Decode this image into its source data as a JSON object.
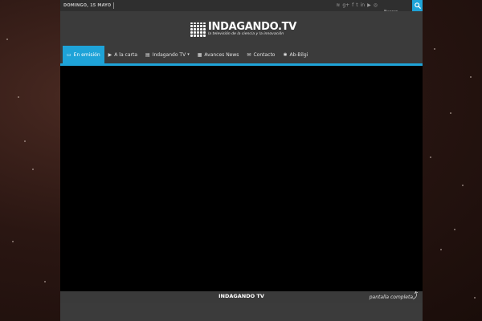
{
  "topbar": {
    "date": "DOMINGO, 15 MAYO",
    "social_icons": [
      "rss-icon",
      "google-plus-icon",
      "facebook-icon",
      "twitter-icon",
      "linkedin-icon",
      "youtube-icon",
      "instagram-icon"
    ],
    "social_glyphs": [
      "≋",
      "g+",
      "f",
      "t",
      "in",
      "▶",
      "◎"
    ],
    "search_placeholder": "Buscar"
  },
  "header": {
    "logo_title": "INDAGANDO.TV",
    "logo_subtitle": "la televisión de la ciencia y la innovación"
  },
  "nav": {
    "items": [
      {
        "label": "En emisión",
        "icon": "tv-icon",
        "glyph": "▭",
        "active": true
      },
      {
        "label": "A la carta",
        "icon": "play-icon",
        "glyph": "▶",
        "active": false
      },
      {
        "label": "Indagando TV",
        "icon": "file-icon",
        "glyph": "▤",
        "active": false,
        "dropdown": true
      },
      {
        "label": "Avances News",
        "icon": "newspaper-icon",
        "glyph": "▦",
        "active": false
      },
      {
        "label": "Contacto",
        "icon": "envelope-icon",
        "glyph": "✉",
        "active": false
      },
      {
        "label": "Ab-Bilgi",
        "icon": "gear-icon",
        "glyph": "✱",
        "active": false
      }
    ]
  },
  "player": {
    "brand": "INDAGANDO TV",
    "fullscreen_label": "pantalla completa"
  },
  "colors": {
    "accent": "#1ea3d8",
    "page_bg": "#3b3b3b",
    "topbar_bg": "#2f2f2f",
    "video_bg": "#000000"
  }
}
